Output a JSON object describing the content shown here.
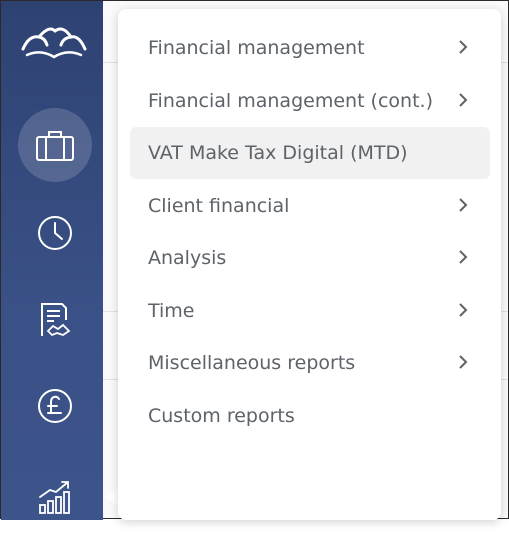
{
  "sidebar": {
    "logo_icon": "brand-birds-logo",
    "items": [
      {
        "name": "briefcase",
        "icon": "briefcase-icon",
        "active": true
      },
      {
        "name": "time",
        "icon": "clock-icon",
        "active": false
      },
      {
        "name": "documents",
        "icon": "document-handshake-icon",
        "active": false
      },
      {
        "name": "billing",
        "icon": "pound-icon",
        "active": false
      },
      {
        "name": "reports",
        "icon": "chart-growth-icon",
        "active": false
      }
    ]
  },
  "reports_menu": {
    "items": [
      {
        "label": "Financial management",
        "has_submenu": true
      },
      {
        "label": "Financial management (cont.)",
        "has_submenu": true
      },
      {
        "label": "VAT Make Tax Digital (MTD)",
        "has_submenu": false,
        "highlighted": true
      },
      {
        "label": "Client financial",
        "has_submenu": true
      },
      {
        "label": "Analysis",
        "has_submenu": true
      },
      {
        "label": "Time",
        "has_submenu": true
      },
      {
        "label": "Miscellaneous reports",
        "has_submenu": true
      },
      {
        "label": "Custom reports",
        "has_submenu": false
      }
    ]
  },
  "colors": {
    "sidebar": "#34497c",
    "menu_text": "#5d6369",
    "highlight": "#f1f1f1"
  }
}
